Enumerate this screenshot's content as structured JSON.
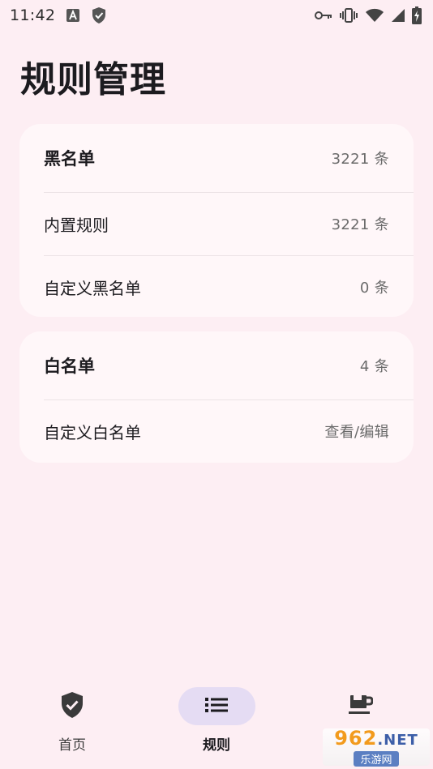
{
  "status_bar": {
    "time": "11:42",
    "left_icons": [
      "text-recognition-icon",
      "shield-check-icon"
    ],
    "right_icons": [
      "key-icon",
      "vibrate-icon",
      "wifi-icon",
      "signal-icon",
      "battery-charging-icon"
    ]
  },
  "page": {
    "title": "规则管理"
  },
  "blacklist_card": {
    "header": {
      "label": "黑名单",
      "value": "3221 条"
    },
    "items": [
      {
        "label": "内置规则",
        "value": "3221 条"
      },
      {
        "label": "自定义黑名单",
        "value": "0 条"
      }
    ]
  },
  "whitelist_card": {
    "header": {
      "label": "白名单",
      "value": "4 条"
    },
    "items": [
      {
        "label": "自定义白名单",
        "value": "查看/编辑"
      }
    ]
  },
  "bottom_nav": {
    "items": [
      {
        "label": "首页",
        "icon": "shield-check-icon",
        "active": false
      },
      {
        "label": "规则",
        "icon": "list-icon",
        "active": true
      },
      {
        "label": "",
        "icon": "coffee-cup-icon",
        "active": false
      }
    ]
  },
  "watermark": {
    "top": "962",
    "top_suffix": ".NET",
    "bottom": "乐游网"
  },
  "colors": {
    "background": "#fdeef3",
    "card": "#fff7f9",
    "active_pill": "#e5dcf3"
  }
}
